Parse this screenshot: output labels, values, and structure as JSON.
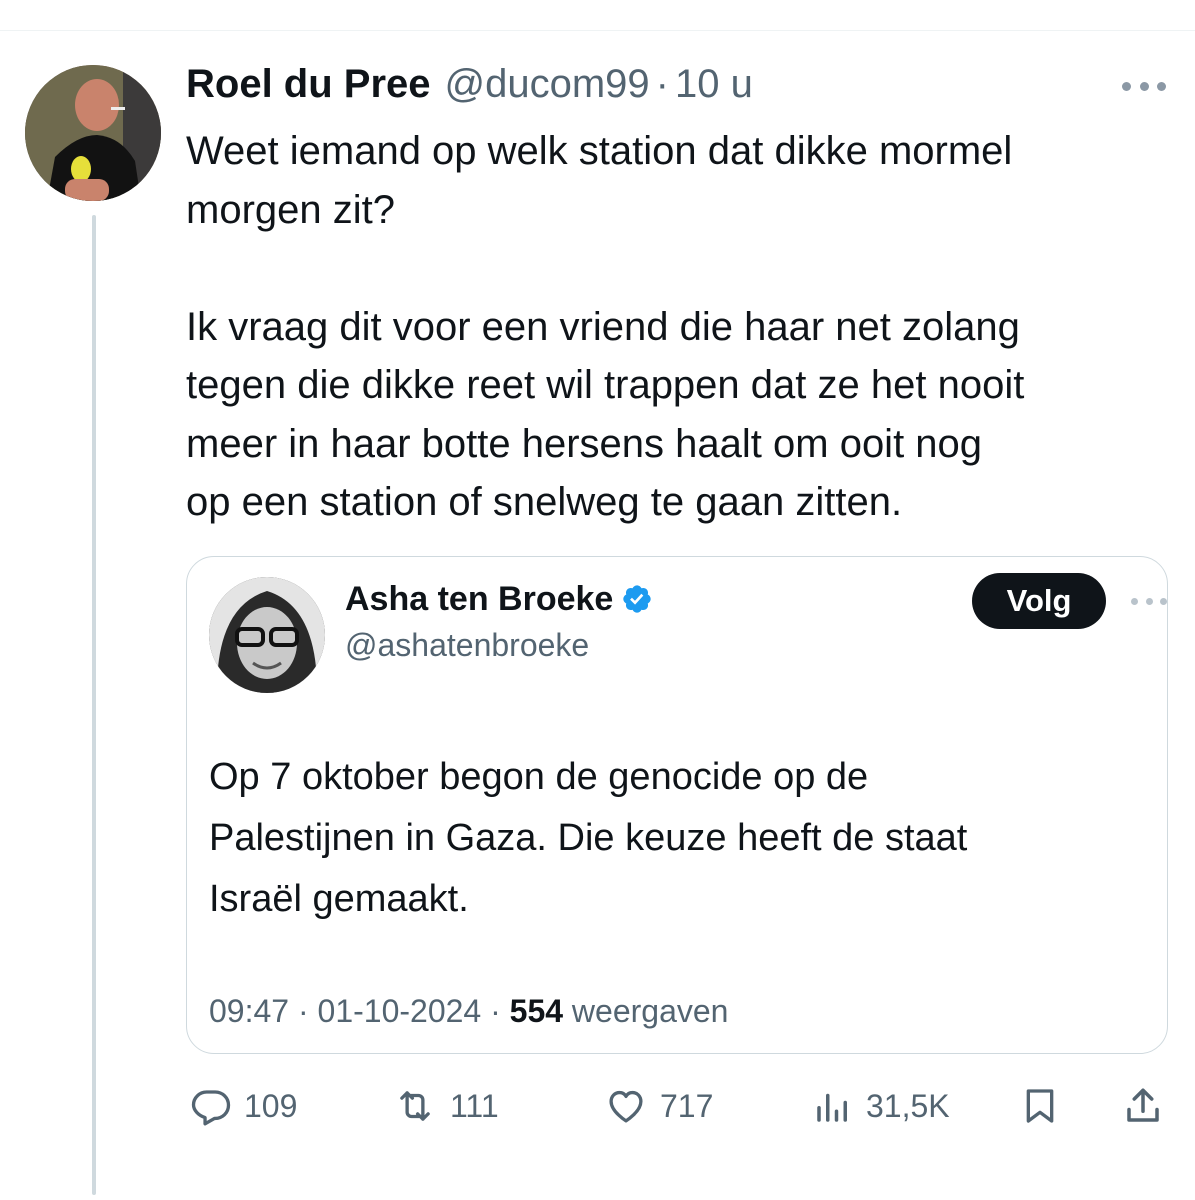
{
  "tweet": {
    "author_name": "Roel du Pree",
    "handle": "@ducom99",
    "separator": "·",
    "time": "10 u",
    "more_icon": "more-horizontal-icon",
    "text": "Weet iemand op welk station dat dikke mormel\nmorgen zit?\n\nIk vraag dit voor een vriend die haar net zolang\ntegen die dikke reet wil trappen dat ze het nooit\nmeer in haar botte hersens haalt om ooit nog\nop een station of snelweg te gaan zitten."
  },
  "quoted": {
    "author_name": "Asha ten Broeke",
    "handle": "@ashatenbroeke",
    "verified_icon": "verified-badge-icon",
    "follow_label": "Volg",
    "text": "Op 7 oktober begon de genocide op de\nPalestijnen in Gaza. Die keuze heeft de staat\nIsraël gemaakt.",
    "time": "09:47",
    "date": "01-10-2024",
    "separator": "·",
    "views_count": "554",
    "views_label": "weergaven"
  },
  "actions": {
    "replies": "109",
    "reposts": "111",
    "likes": "717",
    "views": "31,5K"
  },
  "colors": {
    "text": "#0f1419",
    "secondary": "#536471",
    "border": "#cfd9de",
    "verified": "#1d9bf0",
    "follow_bg": "#0f1419"
  }
}
